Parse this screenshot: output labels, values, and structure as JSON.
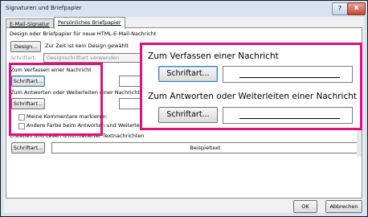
{
  "window": {
    "title": "Signaturen und Briefpapier",
    "help_label": "?",
    "close_label": "x"
  },
  "tabs": [
    {
      "label": "E-Mail-Signatur"
    },
    {
      "label": "Persönliches Briefpapier"
    }
  ],
  "design": {
    "heading": "Design oder Briefpapier für neue HTML-E-Mail-Nachricht",
    "button_label": "Design...",
    "status": "Zur Zeit ist kein Design gewählt",
    "font_label": "Schriftart:",
    "font_value": "Designschriftart verwenden"
  },
  "compose": {
    "heading": "Zum Verfassen einer Nachricht",
    "button_label": "Schriftart..."
  },
  "reply": {
    "heading": "Zum Antworten oder Weiterleiten einer Nachricht",
    "button_label": "Schriftart...",
    "checkbox1_label": "Meine Kommentare markieren:",
    "checkbox2_label": "Andere Farbe beim Antworten und Weiterleiten verwenden"
  },
  "plaintext": {
    "heading": "Erstellen und Lesen unformatierter Textnachrichten",
    "button_label": "Schriftart...",
    "sample": "Beispieltext"
  },
  "zoom": {
    "compose_heading": "Zum Verfassen einer Nachricht",
    "compose_button": "Schriftart...",
    "reply_heading": "Zum Antworten oder Weiterleiten einer Nachricht",
    "reply_button": "Schriftart..."
  },
  "footer": {
    "ok_label": "OK",
    "cancel_label": "Abbrechen"
  },
  "colors": {
    "highlight": "#e0107f",
    "focus": "#3c7fb1"
  }
}
